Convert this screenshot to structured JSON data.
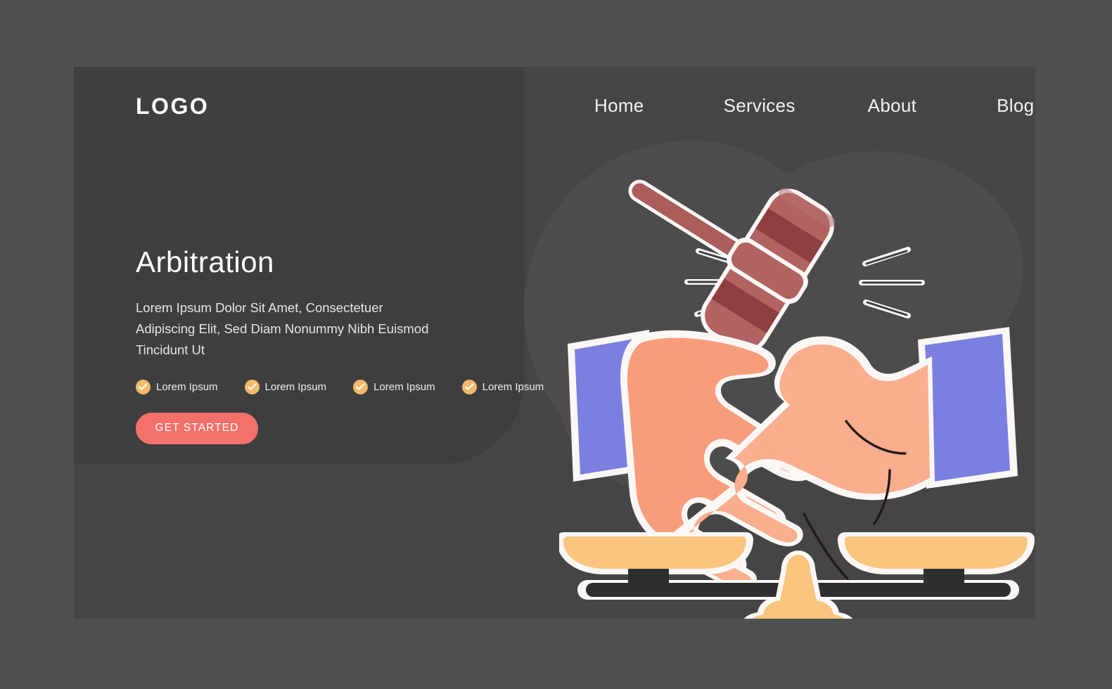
{
  "brand": {
    "logo": "LOGO"
  },
  "nav": {
    "items": [
      {
        "label": "Home"
      },
      {
        "label": "Services"
      },
      {
        "label": "About"
      },
      {
        "label": "Blog"
      }
    ]
  },
  "hero": {
    "title": "Arbitration",
    "subtitle": "Lorem Ipsum Dolor Sit Amet, Consectetuer Adipiscing Elit, Sed Diam Nonummy Nibh Euismod Tincidunt Ut",
    "features": [
      {
        "label": "Lorem Ipsum",
        "icon": "check-circle-icon"
      },
      {
        "label": "Lorem Ipsum",
        "icon": "check-circle-icon"
      },
      {
        "label": "Lorem Ipsum",
        "icon": "check-circle-icon"
      },
      {
        "label": "Lorem Ipsum",
        "icon": "check-circle-icon"
      }
    ],
    "cta_label": "GET STARTED"
  },
  "illustration": {
    "name": "arbitration-handshake-gavel-scales-illustration",
    "parts": [
      "gavel-icon",
      "impact-lines-icon",
      "handshake-icon",
      "justice-scales-icon"
    ]
  },
  "colors": {
    "outer_frame": "#4f4f4f",
    "page_background": "#454545",
    "panel_dark": "#3e3e3e",
    "blob": "#4c4c4c",
    "accent_cta": "#f4706a",
    "check_badge": "#f4ba6b",
    "sleeve_blue": "#7b7fe0",
    "skin": "#f79d7c",
    "skin_light": "#f9ae8e",
    "gavel_light": "#b05f5c",
    "gavel_dark": "#8e3f3f",
    "scales_gold": "#f9c57e",
    "scales_beam": "#2e2e2e",
    "text_primary": "#ffffff",
    "text_secondary": "#e6e6e6",
    "outline_white": "#fbf7f4"
  }
}
